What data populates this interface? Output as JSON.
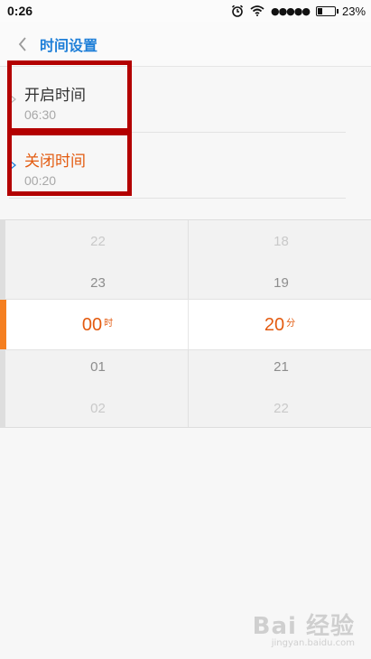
{
  "status_bar": {
    "time": "0:26",
    "battery_percent": 23
  },
  "header": {
    "title": "时间设置"
  },
  "items": [
    {
      "label": "开启时间",
      "value": "06:30"
    },
    {
      "label": "关闭时间",
      "value": "00:20"
    }
  ],
  "picker": {
    "hours": {
      "rows": [
        "22",
        "23",
        "01",
        "02"
      ],
      "selected": "00",
      "unit": "时"
    },
    "minutes": {
      "rows": [
        "18",
        "19",
        "21",
        "22"
      ],
      "selected": "20",
      "unit": "分"
    }
  },
  "colors": {
    "accent": "#e35b10",
    "title_blue": "#1e7fd8",
    "marker_orange": "#f57f20",
    "highlight_red": "#b30000"
  },
  "watermark": {
    "brand": "Bai 经验",
    "url": "jingyan.baidu.com"
  }
}
